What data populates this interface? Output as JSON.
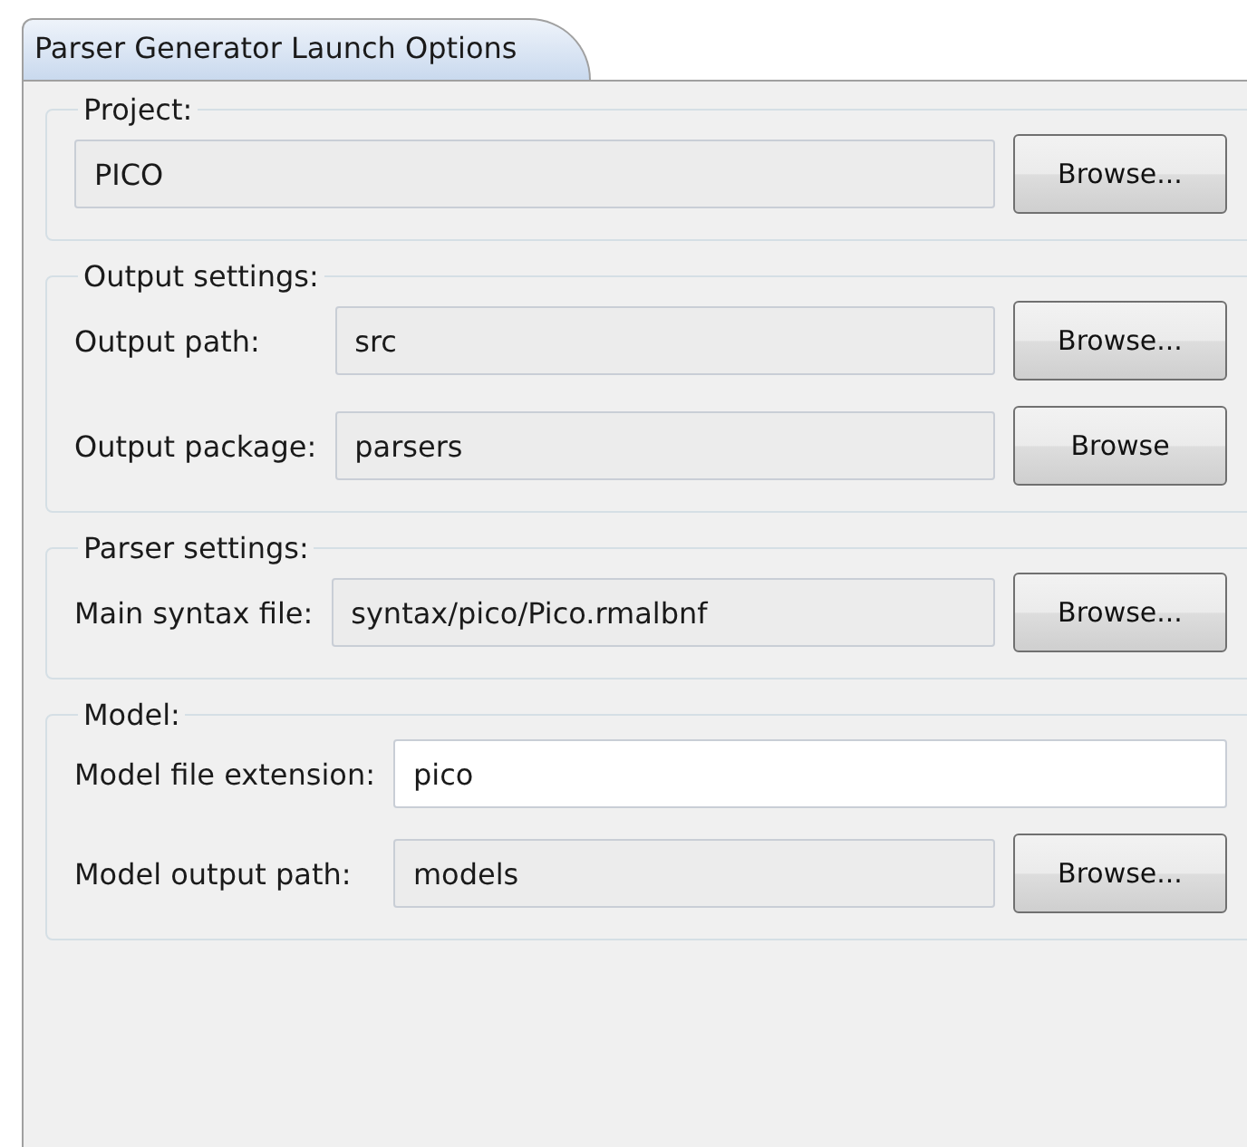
{
  "tabs": [
    {
      "label": "Parser Generator Launch Options",
      "selected": true
    }
  ],
  "groups": [
    {
      "title": "Project:",
      "rows": [
        {
          "value": "PICO",
          "editable": false,
          "button": "Browse..."
        }
      ]
    },
    {
      "title": "Output settings:",
      "rows": [
        {
          "label": "Output path:",
          "value": "src",
          "editable": false,
          "button": "Browse..."
        },
        {
          "label": "Output package:",
          "value": "parsers",
          "editable": false,
          "button": "Browse"
        }
      ]
    },
    {
      "title": "Parser settings:",
      "rows": [
        {
          "label": "Main syntax file:",
          "value": "syntax/pico/Pico.rmalbnf",
          "editable": false,
          "button": "Browse..."
        }
      ]
    },
    {
      "title": "Model:",
      "rows": [
        {
          "label": "Model file extension:",
          "value": "pico",
          "editable": true
        },
        {
          "label": "Model output path:",
          "value": "models",
          "editable": false,
          "button": "Browse..."
        }
      ]
    }
  ]
}
